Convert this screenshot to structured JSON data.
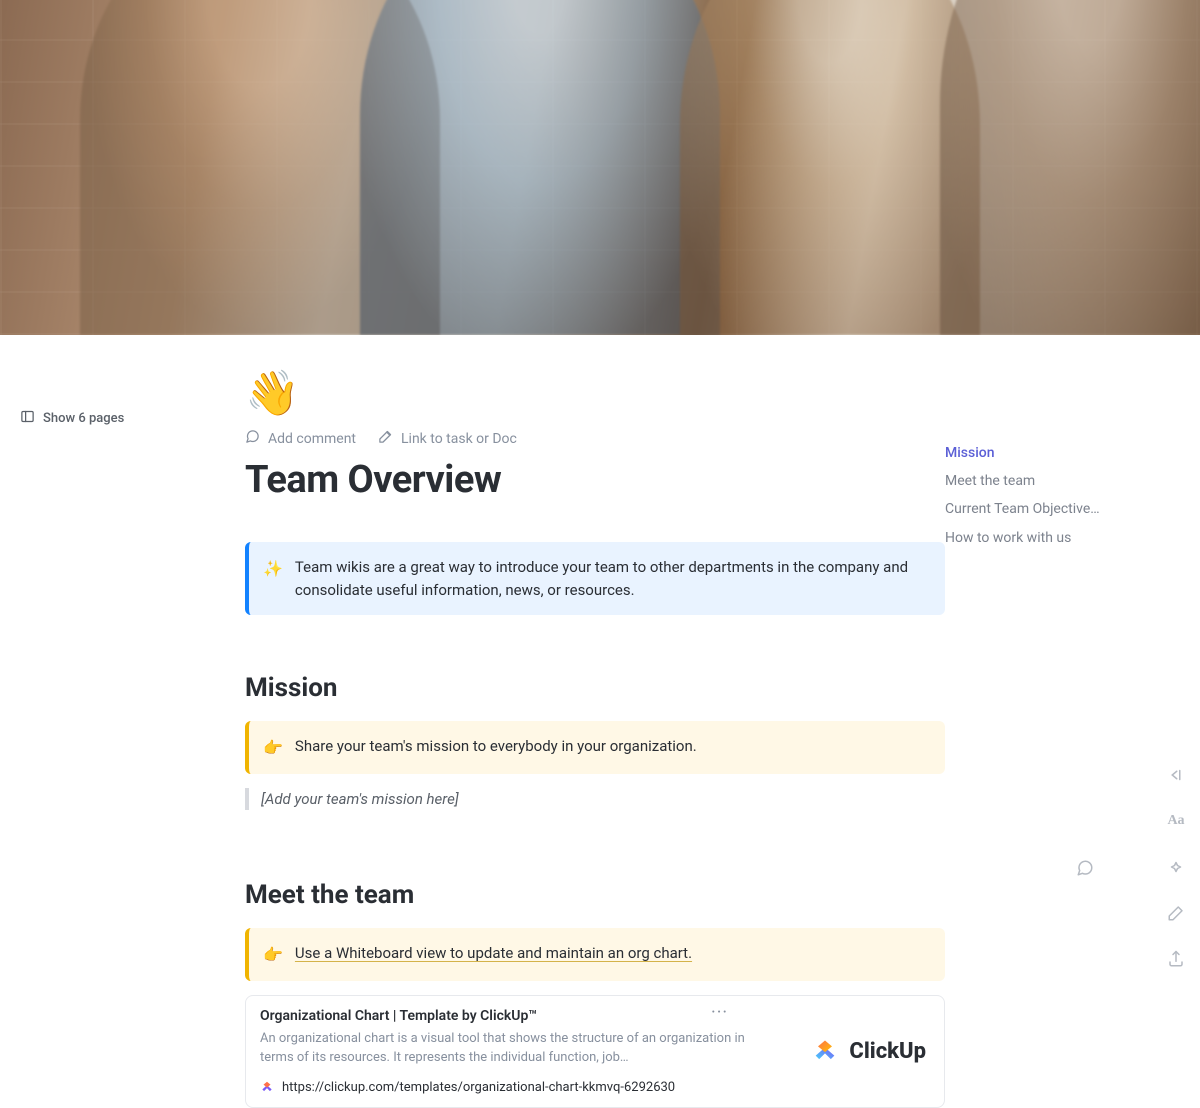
{
  "left": {
    "show_pages": "Show 6 pages"
  },
  "doc": {
    "emoji": "👋",
    "title": "Team Overview",
    "actions": {
      "add_comment": "Add comment",
      "link_task": "Link to task or Doc"
    },
    "intro_callout": {
      "icon": "✨",
      "text": "Team wikis are a great way to introduce your team to other departments in the company and consolidate useful information, news, or resources."
    },
    "sections": {
      "mission": {
        "heading": "Mission",
        "callout_icon": "👉",
        "callout_text": "Share your team's mission to everybody in your organization.",
        "placeholder": "[Add your team's mission here]"
      },
      "meet": {
        "heading": "Meet the team",
        "callout_icon": "👉",
        "callout_text": "Use a Whiteboard view to update and maintain an org chart."
      }
    },
    "link_card": {
      "title": "Organizational Chart | Template by ClickUp™",
      "desc": "An organizational chart is a visual tool that shows the structure of an organization in terms of its resources. It represents the individual function, job…",
      "url": "https://clickup.com/templates/organizational-chart-kkmvq-6292630",
      "brand": "ClickUp"
    }
  },
  "toc": {
    "items": [
      {
        "label": "Mission",
        "active": true
      },
      {
        "label": "Meet the team",
        "active": false
      },
      {
        "label": "Current Team Objective…",
        "active": false
      },
      {
        "label": "How to work with us",
        "active": false
      }
    ]
  },
  "colors": {
    "link_purple": "#5b5fd6",
    "callout_blue": "#1282ff",
    "callout_yellow": "#f0b400"
  }
}
